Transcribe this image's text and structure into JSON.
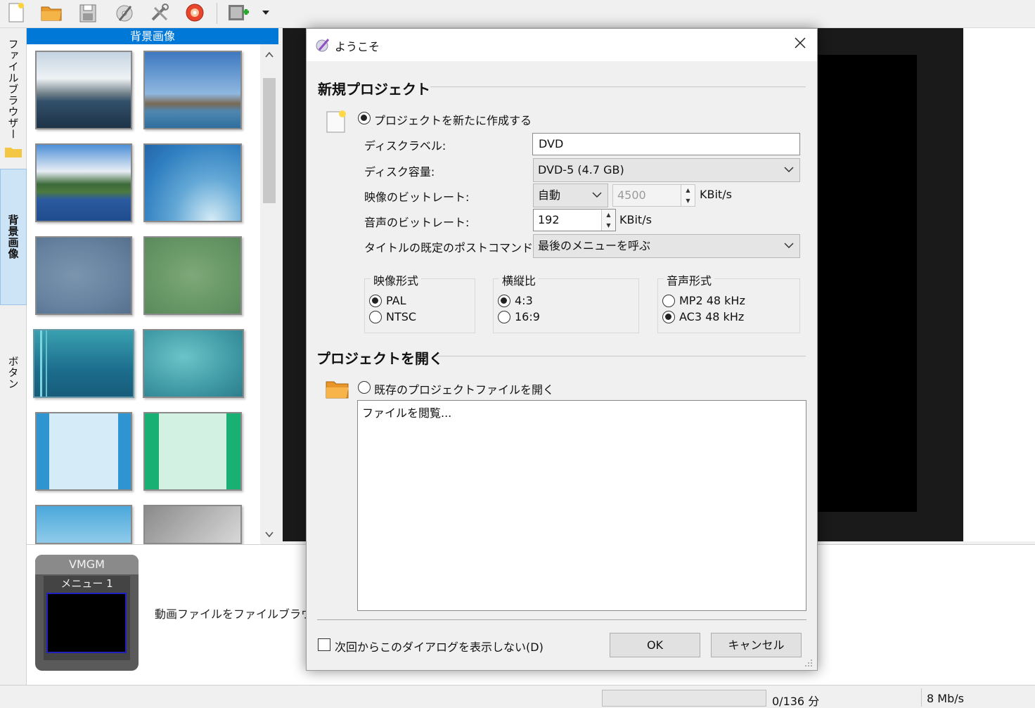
{
  "toolbar": {
    "items": [
      "new-project-icon",
      "open-folder-icon",
      "save-icon",
      "burn-icon",
      "settings-tools-icon",
      "dvd-icon",
      "add-video-icon",
      "dropdown-arrow-icon"
    ]
  },
  "left_tabs": {
    "file_browser": "ファイルブラウザー",
    "backgrounds": "背景画像",
    "buttons": "ボタン"
  },
  "background_panel": {
    "header": "背景画像",
    "scroll_up": "^",
    "scroll_down": "v"
  },
  "menu_area": {
    "vmgm_label": "VMGM",
    "menu_label": "メニュー 1",
    "hint": "動画ファイルをファイルブラウザーから"
  },
  "status_bar": {
    "duration": "0/136 分",
    "bitrate": "8 Mb/s"
  },
  "dialog": {
    "title": "ようこそ",
    "close": "✕",
    "new_project": {
      "heading": "新規プロジェクト",
      "create_radio": "プロジェクトを新たに作成する",
      "disc_label_label": "ディスクラベル:",
      "disc_label_value": "DVD",
      "disc_capacity_label": "ディスク容量:",
      "disc_capacity_value": "DVD-5 (4.7 GB)",
      "video_bitrate_label": "映像のビットレート:",
      "video_bitrate_mode": "自動",
      "video_bitrate_value": "4500",
      "video_bitrate_unit": "KBit/s",
      "audio_bitrate_label": "音声のビットレート:",
      "audio_bitrate_value": "192",
      "audio_bitrate_unit": "KBit/s",
      "post_command_label": "タイトルの既定のポストコマンド:",
      "post_command_value": "最後のメニューを呼ぶ",
      "video_format": {
        "title": "映像形式",
        "options": [
          "PAL",
          "NTSC"
        ],
        "selected": "PAL"
      },
      "aspect_ratio": {
        "title": "横縦比",
        "options": [
          "4:3",
          "16:9"
        ],
        "selected": "4:3"
      },
      "audio_format": {
        "title": "音声形式",
        "options": [
          "MP2 48 kHz",
          "AC3 48 kHz"
        ],
        "selected": "AC3 48 kHz"
      }
    },
    "open_project": {
      "heading": "プロジェクトを開く",
      "open_radio": "既存のプロジェクトファイルを開く",
      "browse_item": "ファイルを閲覧..."
    },
    "dont_show": "次回からこのダイアログを表示しない(D)",
    "ok": "OK",
    "cancel": "キャンセル"
  },
  "colors": {
    "accent": "#0078d7",
    "tab_active": "#cde4f7",
    "preview_bg": "#1a1a1a"
  }
}
